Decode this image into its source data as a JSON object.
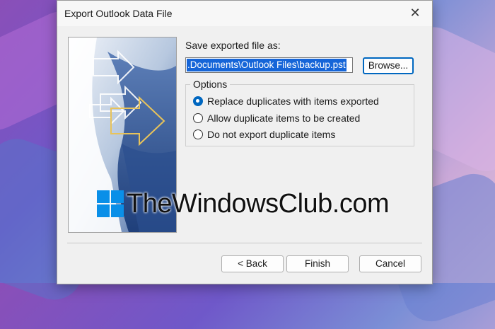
{
  "dialog": {
    "title": "Export Outlook Data File",
    "close_icon": "close-icon"
  },
  "save": {
    "label": "Save exported file as:",
    "path_value": ".Documents\\Outlook Files\\backup.pst",
    "browse_label": "Browse..."
  },
  "options": {
    "legend": "Options",
    "items": [
      {
        "label": "Replace duplicates with items exported",
        "selected": true
      },
      {
        "label": "Allow duplicate items to be created",
        "selected": false
      },
      {
        "label": "Do not export duplicate items",
        "selected": false
      }
    ]
  },
  "watermark": {
    "text": "TheWindowsClub.com"
  },
  "footer": {
    "back_label": "< Back",
    "finish_label": "Finish",
    "cancel_label": "Cancel"
  },
  "colors": {
    "accent": "#0067c0",
    "selection": "#1565d8"
  }
}
